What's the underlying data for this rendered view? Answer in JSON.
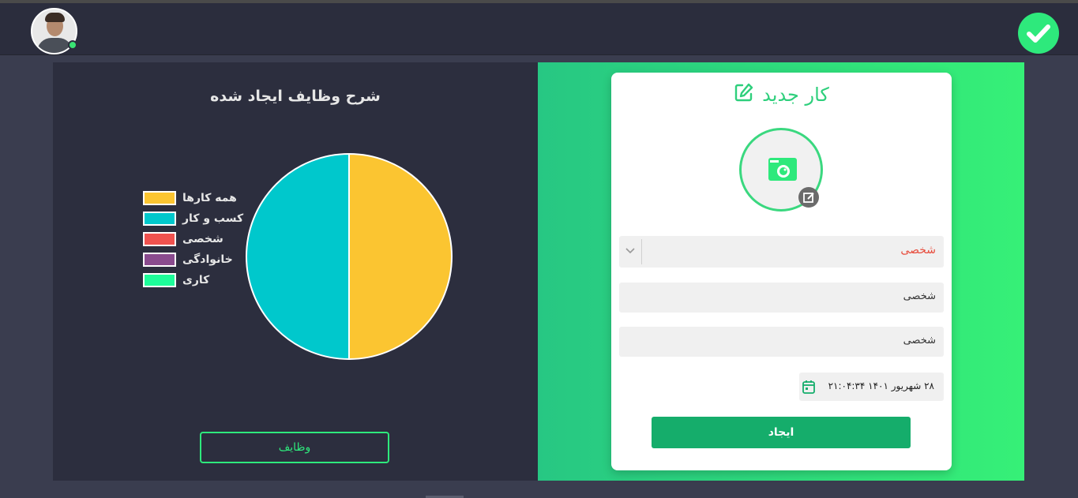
{
  "header": {
    "avatar_alt": "user-avatar",
    "status": "online"
  },
  "chart_panel": {
    "title": "شرح وظایف ایجاد شده",
    "button_label": "وظایف"
  },
  "chart_data": {
    "type": "pie",
    "title": "شرح وظایف ایجاد شده",
    "categories": [
      "همه کارها",
      "کسب و کار",
      "شخصی",
      "خانوادگی",
      "کاری"
    ],
    "values": [
      1,
      1,
      0,
      0,
      0
    ],
    "colors": [
      "#fbc531",
      "#00c8cc",
      "#f0524f",
      "#8a4b8e",
      "#1efc9a"
    ],
    "legend_position": "left"
  },
  "form": {
    "title": "کار جدید",
    "category_select": "شخصی",
    "field1": "شخصی",
    "field2": "شخصی",
    "datetime": "۲۸ شهریور ۱۴۰۱ ۲۱:۰۴:۳۴",
    "submit_label": "ایجاد"
  },
  "colors": {
    "accent": "#2ee97c",
    "header_bg": "#2b2d3d",
    "panel_bg": "#2c2e3e",
    "button_green": "#15ad6b"
  }
}
